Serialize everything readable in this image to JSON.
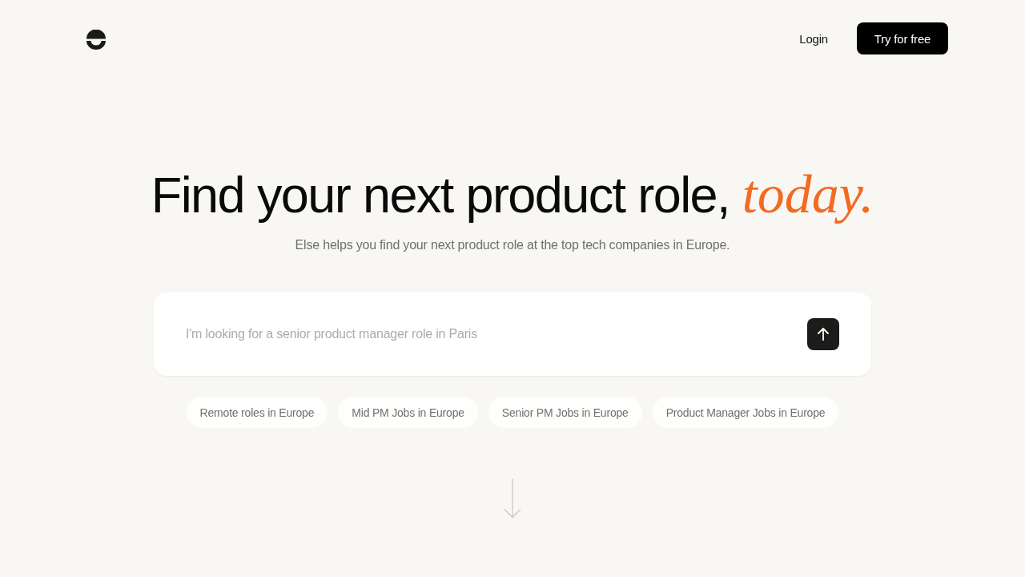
{
  "header": {
    "login": "Login",
    "cta": "Try for free"
  },
  "hero": {
    "title": "Find your next product role, *today.*",
    "subtitle": "Else helps you find your next product role at the top tech companies in Europe."
  },
  "search": {
    "placeholder": "I'm looking for a senior product manager role in Paris"
  },
  "suggestions": [
    "Remote roles in Europe",
    "Mid PM Jobs in Europe",
    "Senior PM Jobs in Europe",
    "Product Manager Jobs in Europe"
  ]
}
